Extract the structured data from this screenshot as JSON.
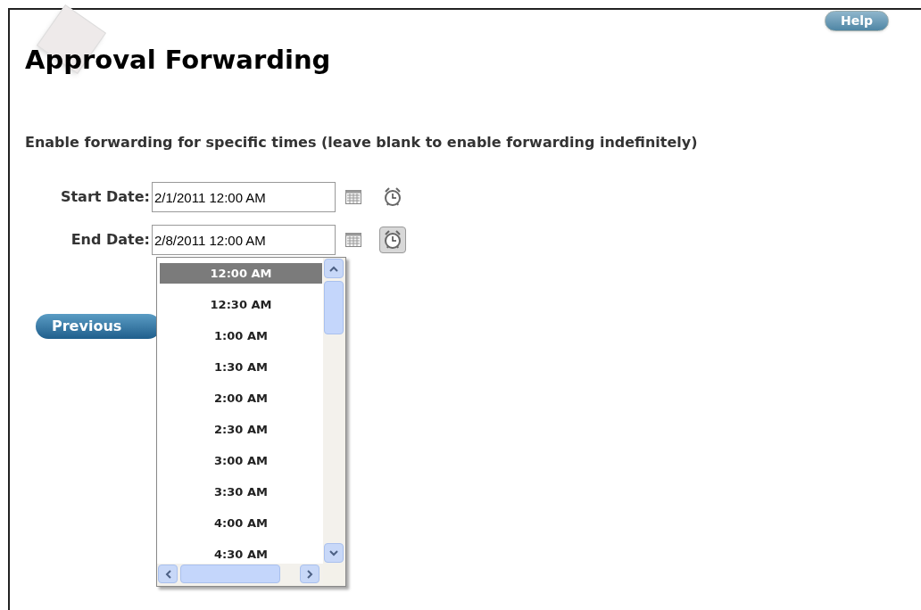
{
  "help_button": "Help",
  "title": "Approval Forwarding",
  "instruction": "Enable forwarding for specific times (leave blank to enable forwarding indefinitely)",
  "fields": [
    {
      "label": "Start Date:",
      "value": "2/1/2011 12:00 AM",
      "time_picker_open": false
    },
    {
      "label": "End Date:",
      "value": "2/8/2011 12:00 AM",
      "time_picker_open": true
    }
  ],
  "time_dropdown": {
    "items": [
      {
        "label": "12:00 AM",
        "selected": true
      },
      {
        "label": "12:30 AM",
        "selected": false
      },
      {
        "label": "1:00 AM",
        "selected": false
      },
      {
        "label": "1:30 AM",
        "selected": false
      },
      {
        "label": "2:00 AM",
        "selected": false
      },
      {
        "label": "2:30 AM",
        "selected": false
      },
      {
        "label": "3:00 AM",
        "selected": false
      },
      {
        "label": "3:30 AM",
        "selected": false
      },
      {
        "label": "4:00 AM",
        "selected": false
      },
      {
        "label": "4:30 AM",
        "selected": false
      }
    ]
  },
  "previous_button": "Previous"
}
